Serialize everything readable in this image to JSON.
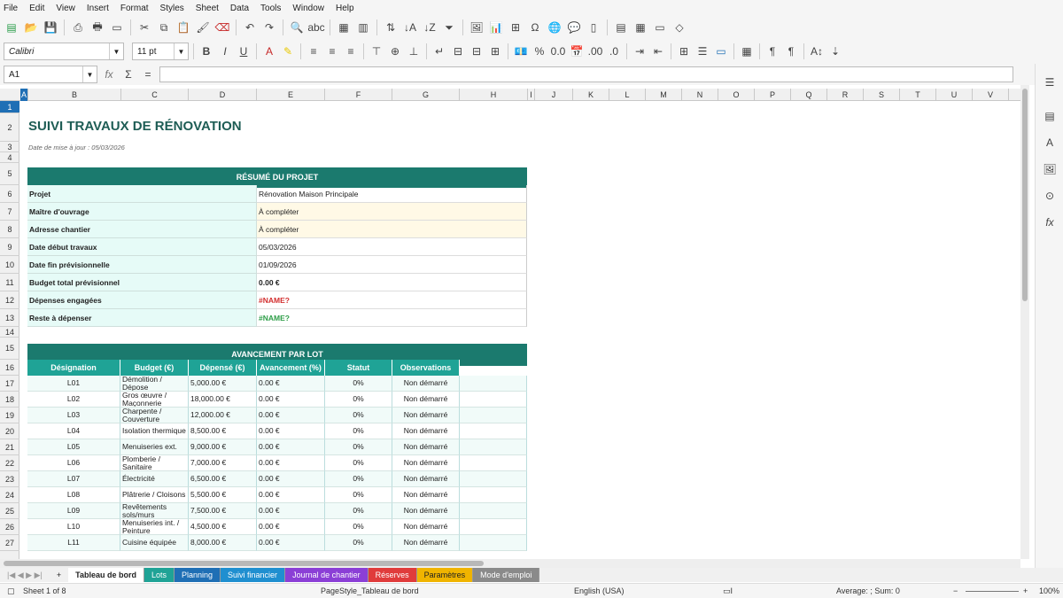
{
  "menu": [
    "File",
    "Edit",
    "View",
    "Insert",
    "Format",
    "Styles",
    "Sheet",
    "Data",
    "Tools",
    "Window",
    "Help"
  ],
  "toolbar": {
    "font_name": "Calibri",
    "font_size": "11 pt"
  },
  "formula_bar": {
    "cell_ref": "A1",
    "fx": "fx",
    "sigma": "Σ",
    "eq": "="
  },
  "columns": [
    "A",
    "B",
    "C",
    "D",
    "E",
    "F",
    "G",
    "H",
    "I",
    "J",
    "K",
    "L",
    "M",
    "N",
    "O",
    "P",
    "Q",
    "R",
    "S",
    "T",
    "U",
    "V"
  ],
  "rows": [
    "1",
    "2",
    "3",
    "4",
    "5",
    "6",
    "7",
    "8",
    "9",
    "10",
    "11",
    "12",
    "13",
    "14",
    "15",
    "16",
    "17",
    "18",
    "19",
    "20",
    "21",
    "22",
    "23",
    "24",
    "25",
    "26",
    "27"
  ],
  "sheet": {
    "title": "SUIVI TRAVAUX DE RÉNOVATION",
    "updated": "Date de mise à jour : 05/03/2026",
    "summary_header": "RÉSUMÉ DU PROJET",
    "summary": [
      {
        "label": "Projet",
        "value": "Rénovation Maison Principale"
      },
      {
        "label": "Maître d'ouvrage",
        "value": "À compléter"
      },
      {
        "label": "Adresse chantier",
        "value": "À compléter"
      },
      {
        "label": "Date début travaux",
        "value": "05/03/2026"
      },
      {
        "label": "Date fin prévisionnelle",
        "value": "01/09/2026"
      },
      {
        "label": "Budget total prévisionnel",
        "value": "0.00 €"
      },
      {
        "label": "Dépenses engagées",
        "value": "#NAME?"
      },
      {
        "label": "Reste à dépenser",
        "value": "#NAME?"
      }
    ],
    "progress_header": "AVANCEMENT PAR LOT",
    "table_headers": [
      "Désignation",
      "Budget (€)",
      "Dépensé (€)",
      "Avancement (%)",
      "Statut",
      "Observations"
    ],
    "lots": [
      {
        "code": "L01",
        "name": "Démolition / Dépose",
        "budget": "5,000.00 €",
        "spent": "0.00 €",
        "pct": "0%",
        "status": "Non démarré"
      },
      {
        "code": "L02",
        "name": "Gros œuvre / Maçonnerie",
        "budget": "18,000.00 €",
        "spent": "0.00 €",
        "pct": "0%",
        "status": "Non démarré"
      },
      {
        "code": "L03",
        "name": "Charpente / Couverture",
        "budget": "12,000.00 €",
        "spent": "0.00 €",
        "pct": "0%",
        "status": "Non démarré"
      },
      {
        "code": "L04",
        "name": "Isolation thermique",
        "budget": "8,500.00 €",
        "spent": "0.00 €",
        "pct": "0%",
        "status": "Non démarré"
      },
      {
        "code": "L05",
        "name": "Menuiseries ext.",
        "budget": "9,000.00 €",
        "spent": "0.00 €",
        "pct": "0%",
        "status": "Non démarré"
      },
      {
        "code": "L06",
        "name": "Plomberie / Sanitaire",
        "budget": "7,000.00 €",
        "spent": "0.00 €",
        "pct": "0%",
        "status": "Non démarré"
      },
      {
        "code": "L07",
        "name": "Électricité",
        "budget": "6,500.00 €",
        "spent": "0.00 €",
        "pct": "0%",
        "status": "Non démarré"
      },
      {
        "code": "L08",
        "name": "Plâtrerie / Cloisons",
        "budget": "5,500.00 €",
        "spent": "0.00 €",
        "pct": "0%",
        "status": "Non démarré"
      },
      {
        "code": "L09",
        "name": "Revêtements sols/murs",
        "budget": "7,500.00 €",
        "spent": "0.00 €",
        "pct": "0%",
        "status": "Non démarré"
      },
      {
        "code": "L10",
        "name": "Menuiseries int. / Peinture",
        "budget": "4,500.00 €",
        "spent": "0.00 €",
        "pct": "0%",
        "status": "Non démarré"
      },
      {
        "code": "L11",
        "name": "Cuisine équipée",
        "budget": "8,000.00 €",
        "spent": "0.00 €",
        "pct": "0%",
        "status": "Non démarré"
      }
    ]
  },
  "tabs": [
    {
      "label": "Tableau de bord",
      "color": "#ffffff"
    },
    {
      "label": "Lots",
      "color": "#1fa396"
    },
    {
      "label": "Planning",
      "color": "#1f6fb5"
    },
    {
      "label": "Suivi financier",
      "color": "#1f8fd0"
    },
    {
      "label": "Journal de chantier",
      "color": "#8b3fd6"
    },
    {
      "label": "Réserves",
      "color": "#e03b3b"
    },
    {
      "label": "Paramètres",
      "color": "#f0b400"
    },
    {
      "label": "Mode d'emploi",
      "color": "#8a8a8a"
    }
  ],
  "status": {
    "sheet": "Sheet 1 of 8",
    "page_style": "PageStyle_Tableau de bord",
    "lang": "English (USA)",
    "sum": "Average: ; Sum: 0",
    "zoom": "100%"
  }
}
